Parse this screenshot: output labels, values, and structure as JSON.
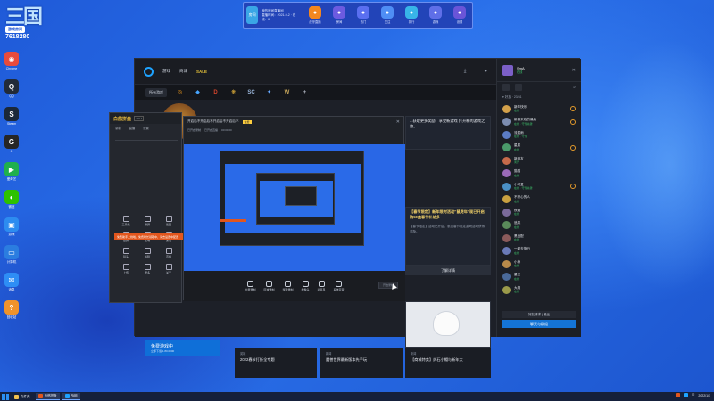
{
  "watermark": {
    "logo": "三国",
    "badge": "游戏房间",
    "id": "7618280"
  },
  "top_widget": {
    "avatar_label": "房间",
    "info_lines": [
      "我的房间直播间",
      "直播时间：2021-9-2 · 在线：9"
    ],
    "buttons": [
      {
        "label": "虎牙直播",
        "icon": "tiger-icon",
        "color": "#f4871f"
      },
      {
        "label": "房间",
        "icon": "house-icon",
        "color": "#6c5be0"
      },
      {
        "label": "热门",
        "icon": "star-icon",
        "color": "#5a6ff0"
      },
      {
        "label": "关注",
        "icon": "heart-icon",
        "color": "#4f8ef5"
      },
      {
        "label": "排行",
        "icon": "chart-icon",
        "color": "#38b5e8"
      },
      {
        "label": "游戏",
        "icon": "gamepad-icon",
        "color": "#5f6fe8"
      },
      {
        "label": "设置",
        "icon": "gear-icon",
        "color": "#6a55d8"
      }
    ]
  },
  "desktop_icons": [
    {
      "label": "Chrome",
      "icon": "chrome-icon",
      "color": "#e84b3c",
      "glyph": "◉"
    },
    {
      "label": "QQ",
      "icon": "qq-icon",
      "color": "#222b38",
      "glyph": "Q"
    },
    {
      "label": "Steam",
      "icon": "steam-icon",
      "color": "#1b2838",
      "glyph": "S"
    },
    {
      "label": "G",
      "icon": "g-icon",
      "color": "#262626",
      "glyph": "G"
    },
    {
      "label": "爱奇艺",
      "icon": "play-icon",
      "color": "#20b04d",
      "glyph": "▶"
    },
    {
      "label": "微信",
      "icon": "wechat-icon",
      "color": "#2dc100",
      "glyph": "◐"
    },
    {
      "label": "游戏",
      "icon": "game-icon",
      "color": "#2d8cf0",
      "glyph": "▣"
    },
    {
      "label": "计算机",
      "icon": "computer-icon",
      "color": "#2b7de0",
      "glyph": "▭"
    },
    {
      "label": "消息",
      "icon": "message-icon",
      "color": "#2e8ef5",
      "glyph": "✉"
    },
    {
      "label": "回收站",
      "icon": "help-icon",
      "color": "#f0932b",
      "glyph": "?"
    }
  ],
  "bnet": {
    "nav": [
      "游戏",
      "商城",
      "SALE"
    ],
    "all_games": "所有游戏",
    "games": [
      {
        "name": "overwatch-icon",
        "glyph": "◎",
        "color": "#f99e1a"
      },
      {
        "name": "hearthstone-icon",
        "glyph": "◆",
        "color": "#47a6ff"
      },
      {
        "name": "diablo-icon",
        "glyph": "D",
        "color": "#d6452c"
      },
      {
        "name": "wow-icon",
        "glyph": "❋",
        "color": "#e8b43a"
      },
      {
        "name": "starcraft2-icon",
        "glyph": "SC",
        "color": "#9ab5d9"
      },
      {
        "name": "heroes-icon",
        "glyph": "✦",
        "color": "#66a8ff"
      },
      {
        "name": "classic-icon",
        "glyph": "W",
        "color": "#c9a85c"
      },
      {
        "name": "add-icon",
        "glyph": "+",
        "color": "#b0b6c2"
      }
    ],
    "news_top": "...获取更多奖励，享受新游戏 打开新的游戏之旅。",
    "news_main_title": "【春节限定】新年限时活动“鼠虎年”现已开启 购50盒春节补给多",
    "news_main_body": "【春节限定】活动已开启，参加春节限定游戏活动获得奖励。",
    "learn_more": "了解详情",
    "blue_card_title": "免费游戏中",
    "blue_card_sub": "立即下载 1.80.0000",
    "bottom_cards": [
      {
        "small": "英雄",
        "title": "2022春节打折全专题"
      },
      {
        "small": "新闻",
        "title": "魔兽世界最新版本先手玩"
      },
      {
        "small": "新闻",
        "title": "【商城特卖】炉石小帽与新年大"
      }
    ]
  },
  "friends": {
    "user_name": "SmA",
    "user_status": "在线",
    "group_label": "▾ 好友 · 23/51",
    "list": [
      {
        "name": "新年快乐",
        "status": "在线",
        "color": "#d2a04a",
        "ow": true
      },
      {
        "name": "新春来临的最后",
        "status": "在线 · 守望先锋",
        "color": "#7c8db0",
        "ow": true
      },
      {
        "name": "流星雨",
        "status": "在线 · 守望",
        "color": "#5b7cc4",
        "ow": false
      },
      {
        "name": "星辰",
        "status": "在线",
        "color": "#4a9a6a",
        "ow": true
      },
      {
        "name": "新朋友",
        "status": "离开",
        "color": "#c56a4a",
        "ow": false
      },
      {
        "name": "猫猫",
        "status": "在线",
        "color": "#9a6ab8",
        "ow": false
      },
      {
        "name": "小可爱",
        "status": "在线 · 守望先锋",
        "color": "#4a90c5",
        "ow": true
      },
      {
        "name": "不开心的人",
        "status": "在线",
        "color": "#c8a040",
        "ow": false
      },
      {
        "name": "夜路",
        "status": "在线",
        "color": "#7a6a9a",
        "ow": false
      },
      {
        "name": "追风",
        "status": "在线",
        "color": "#5a8a5a",
        "ow": false
      },
      {
        "name": "黑白配",
        "status": "在线",
        "color": "#8a5a5a",
        "ow": false
      },
      {
        "name": "一起去旅行",
        "status": "在线",
        "color": "#6a7ab8",
        "ow": false
      },
      {
        "name": "小熊",
        "status": "在线",
        "color": "#b88a4a",
        "ow": false
      },
      {
        "name": "星空",
        "status": "在线",
        "color": "#4a6a9a",
        "ow": false
      },
      {
        "name": "大雄",
        "status": "在线",
        "color": "#9a9a4a",
        "ow": false
      }
    ],
    "footer_tabs": "好友请求  |  最近",
    "footer_button": "聊天与群组"
  },
  "capture_app": {
    "logo": "白鸽拼盘",
    "version": "v10.1",
    "tabs": [
      "录制",
      "直播",
      "设置"
    ],
    "banner": "免费助手上线啦，免费时长领取中，请去设置中配置",
    "grid": [
      "工具箱",
      "录屏",
      "截图",
      "全屏",
      "区域",
      "游戏",
      "镜头",
      "剪辑",
      "直播",
      "上传",
      "更多",
      "关于"
    ]
  },
  "preview": {
    "title": "开启后不开启后不开启后不开启后不",
    "badge": "免费",
    "sub_items": [
      "已开启录制",
      "已开启直播",
      "00:00:00"
    ],
    "controls": [
      "全屏录制",
      "区域录制",
      "游戏录制",
      "摄像头",
      "麦克风",
      "系统声音"
    ],
    "start_btn": "开始录制"
  },
  "taskbar": {
    "items": [
      {
        "label": "文件夹",
        "color": "#f2c14e",
        "active": false
      },
      {
        "label": "白鸽拼盘",
        "color": "#e2561d",
        "active": true
      },
      {
        "label": "战网",
        "color": "#1ea3ff",
        "active": true
      }
    ],
    "tray": [
      "中",
      "2022/1/1"
    ]
  }
}
